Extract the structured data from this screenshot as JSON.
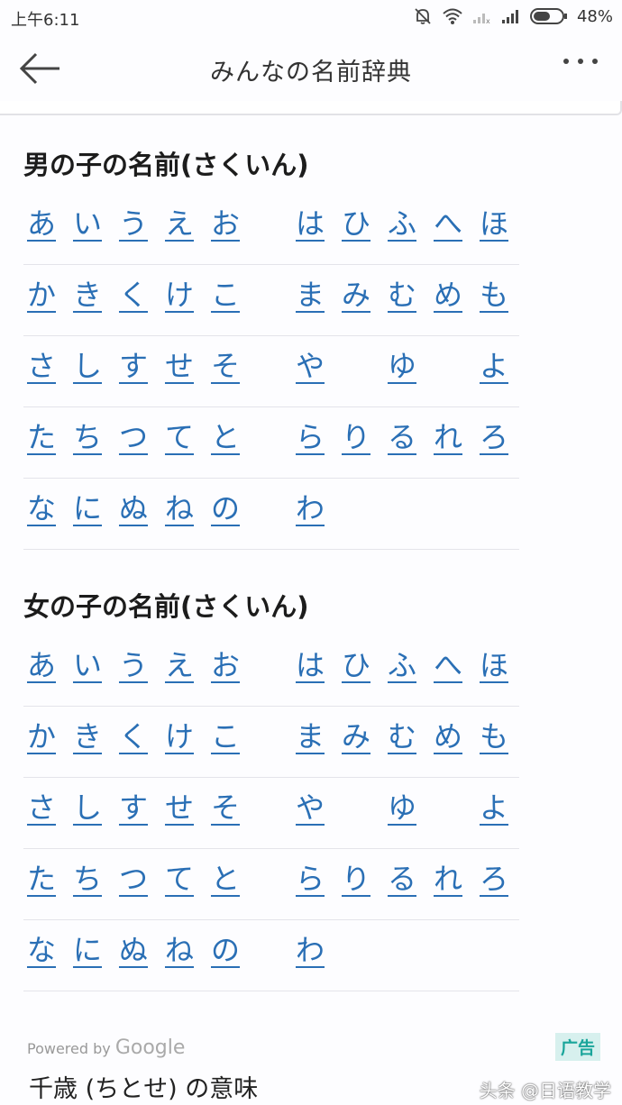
{
  "status_bar": {
    "time": "上午6:11",
    "battery": "48%"
  },
  "app_bar": {
    "title": "みんなの名前辞典"
  },
  "sections": [
    {
      "title": "男の子の名前(さくいん)",
      "rows": [
        [
          "あ",
          "い",
          "う",
          "え",
          "お",
          "は",
          "ひ",
          "ふ",
          "へ",
          "ほ"
        ],
        [
          "か",
          "き",
          "く",
          "け",
          "こ",
          "ま",
          "み",
          "む",
          "め",
          "も"
        ],
        [
          "さ",
          "し",
          "す",
          "せ",
          "そ",
          "や",
          "",
          "ゆ",
          "",
          "よ"
        ],
        [
          "た",
          "ち",
          "つ",
          "て",
          "と",
          "ら",
          "り",
          "る",
          "れ",
          "ろ"
        ],
        [
          "な",
          "に",
          "ぬ",
          "ね",
          "の",
          "わ",
          "",
          "",
          "",
          ""
        ]
      ]
    },
    {
      "title": "女の子の名前(さくいん)",
      "rows": [
        [
          "あ",
          "い",
          "う",
          "え",
          "お",
          "は",
          "ひ",
          "ふ",
          "へ",
          "ほ"
        ],
        [
          "か",
          "き",
          "く",
          "け",
          "こ",
          "ま",
          "み",
          "む",
          "め",
          "も"
        ],
        [
          "さ",
          "し",
          "す",
          "せ",
          "そ",
          "や",
          "",
          "ゆ",
          "",
          "よ"
        ],
        [
          "た",
          "ち",
          "つ",
          "て",
          "と",
          "ら",
          "り",
          "る",
          "れ",
          "ろ"
        ],
        [
          "な",
          "に",
          "ぬ",
          "ね",
          "の",
          "わ",
          "",
          "",
          "",
          ""
        ]
      ]
    }
  ],
  "ad": {
    "powered_prefix": "Powered by",
    "powered_brand": "Google",
    "badge": "广告",
    "text": "千歳 (ちとせ) の意味"
  },
  "watermark": "头条 @日语教学"
}
